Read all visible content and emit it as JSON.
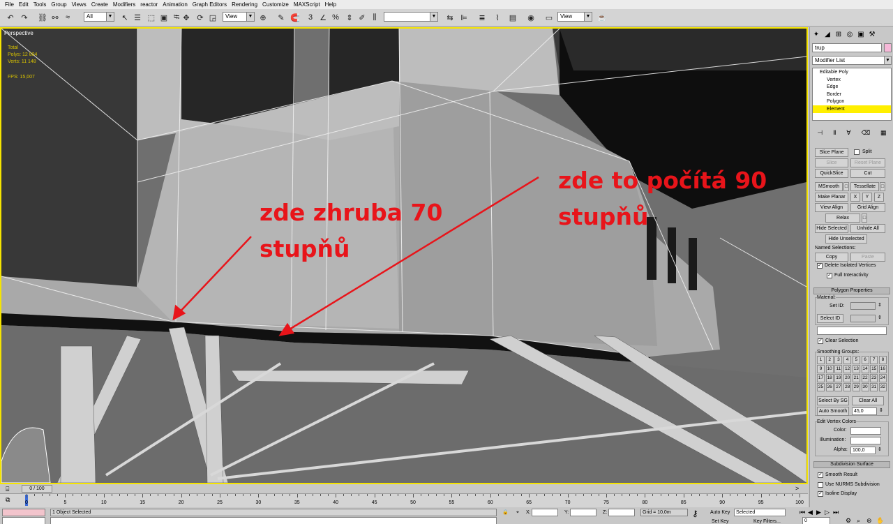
{
  "menu": [
    "File",
    "Edit",
    "Tools",
    "Group",
    "Views",
    "Create",
    "Modifiers",
    "reactor",
    "Animation",
    "Graph Editors",
    "Rendering",
    "Customize",
    "MAXScript",
    "Help"
  ],
  "toolbar": {
    "selection_filter": "All",
    "ref_coord_1": "View",
    "named_selection": "",
    "ref_coord_2": "View"
  },
  "viewport": {
    "label": "Perspective",
    "stats": [
      "Total",
      "Polys:   12 804",
      "Verts:   11 148"
    ],
    "fps": "FPS:    15,007"
  },
  "annotations": {
    "left": [
      "zde zhruba 70",
      "stupňů"
    ],
    "right": [
      "zde to počítá 90",
      "stupňů"
    ]
  },
  "command_panel": {
    "object_name": "trup",
    "object_color": "#f6b8d8",
    "modifier_list": "Modifier List",
    "stack": [
      {
        "label": "Editable Poly",
        "level": 0,
        "selected": false
      },
      {
        "label": "Vertex",
        "level": 1,
        "selected": false
      },
      {
        "label": "Edge",
        "level": 1,
        "selected": false
      },
      {
        "label": "Border",
        "level": 1,
        "selected": false
      },
      {
        "label": "Polygon",
        "level": 1,
        "selected": false
      },
      {
        "label": "Element",
        "level": 1,
        "selected": true
      }
    ],
    "buttons": {
      "slice_plane": "Slice Plane",
      "split": "Split",
      "slice": "Slice",
      "reset_plane": "Reset Plane",
      "quickslice": "QuickSlice",
      "cut": "Cut",
      "msmooth": "MSmooth",
      "tessellate": "Tessellate",
      "make_planar": "Make Planar",
      "x": "X",
      "y": "Y",
      "z": "Z",
      "view_align": "View Align",
      "grid_align": "Grid Align",
      "relax": "Relax",
      "hide_selected": "Hide Selected",
      "unhide_all": "Unhide All",
      "hide_unselected": "Hide Unselected",
      "copy": "Copy",
      "paste": "Paste",
      "select_id": "Select ID",
      "select_by_sg": "Select By SG",
      "clear_all": "Clear All",
      "auto_smooth": "Auto Smooth"
    },
    "labels": {
      "named_selections": "Named Selections:",
      "delete_isolated": "Delete Isolated Vertices",
      "full_interactivity": "Full Interactivity",
      "polygon_properties": "Polygon Properties",
      "material": "Material:",
      "set_id": "Set ID:",
      "clear_selection": "Clear Selection",
      "smoothing_groups": "Smoothing Groups:",
      "auto_smooth_value": "45,0",
      "edit_vertex_colors": "Edit Vertex Colors",
      "color": "Color:",
      "illumination": "Illumination:",
      "alpha": "Alpha:",
      "alpha_value": "100,0",
      "subdivision_surface": "Subdivision Surface",
      "smooth_result": "Smooth Result",
      "use_nurms": "Use NURMS Subdivision",
      "isoline_display": "Isoline Display"
    },
    "smoothing_numbers": [
      "1",
      "2",
      "3",
      "4",
      "5",
      "6",
      "7",
      "8",
      "9",
      "10",
      "11",
      "12",
      "13",
      "14",
      "15",
      "16",
      "17",
      "18",
      "19",
      "20",
      "21",
      "22",
      "23",
      "24",
      "25",
      "26",
      "27",
      "28",
      "29",
      "30",
      "31",
      "32"
    ]
  },
  "timeslider": {
    "position": "0 / 100"
  },
  "track": {
    "ticks": [
      "0",
      "5",
      "10",
      "15",
      "20",
      "25",
      "30",
      "35",
      "40",
      "45",
      "50",
      "55",
      "60",
      "65",
      "70",
      "75",
      "80",
      "85",
      "90",
      "95",
      "100"
    ]
  },
  "status": {
    "selected": "1 Object Selected",
    "x_label": "X:",
    "y_label": "Y:",
    "z_label": "Z:",
    "grid": "Grid = 10,0m",
    "auto_key": "Auto Key",
    "auto_key_mode": "Selected",
    "set_key": "Set Key",
    "key_filters": "Key Filters...",
    "frame": "0"
  }
}
